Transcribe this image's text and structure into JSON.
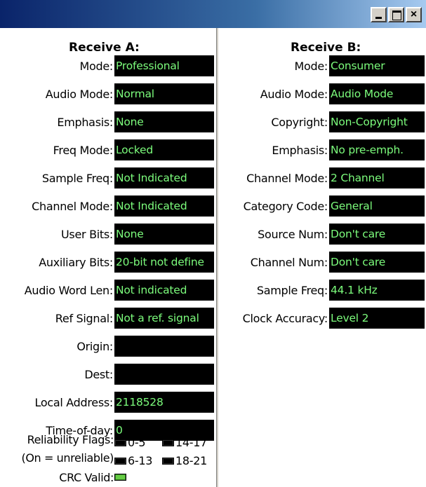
{
  "window": {
    "buttons": {
      "minimize": "_",
      "maximize": "□",
      "close": "×"
    }
  },
  "receive_a": {
    "heading": "Receive A:",
    "fields": [
      {
        "label": "Mode:",
        "value": "Professional"
      },
      {
        "label": "Audio Mode:",
        "value": "Normal"
      },
      {
        "label": "Emphasis:",
        "value": "None"
      },
      {
        "label": "Freq Mode:",
        "value": "Locked"
      },
      {
        "label": "Sample Freq:",
        "value": "Not Indicated"
      },
      {
        "label": "Channel Mode:",
        "value": "Not Indicated"
      },
      {
        "label": "User Bits:",
        "value": "None"
      },
      {
        "label": "Auxiliary Bits:",
        "value": "20-bit not define"
      },
      {
        "label": "Audio Word Len:",
        "value": "Not indicated"
      },
      {
        "label": "Ref Signal:",
        "value": "Not a ref. signal"
      },
      {
        "label": "Origin:",
        "value": ""
      },
      {
        "label": "Dest:",
        "value": ""
      },
      {
        "label": "Local Address:",
        "value": "2118528"
      },
      {
        "label": "Time-of-day:",
        "value": "0"
      }
    ],
    "reliability": {
      "label_line1": "Reliability Flags:",
      "label_line2": "(On = unreliable)",
      "flags": [
        "0-5",
        "14-17",
        "6-13",
        "18-21"
      ]
    },
    "crc": {
      "label": "CRC Valid:",
      "state": "on",
      "color": "#66cc44"
    }
  },
  "receive_b": {
    "heading": "Receive B:",
    "fields": [
      {
        "label": "Mode:",
        "value": "Consumer"
      },
      {
        "label": "Audio Mode:",
        "value": "Audio Mode"
      },
      {
        "label": "Copyright:",
        "value": "Non-Copyright"
      },
      {
        "label": "Emphasis:",
        "value": "No pre-emph."
      },
      {
        "label": "Channel Mode:",
        "value": "2 Channel"
      },
      {
        "label": "Category Code:",
        "value": "General"
      },
      {
        "label": "Source Num:",
        "value": "Don't care"
      },
      {
        "label": "Channel Num:",
        "value": "Don't care"
      },
      {
        "label": "Sample Freq:",
        "value": "44.1 kHz"
      },
      {
        "label": "Clock Accuracy:",
        "value": "Level 2"
      }
    ]
  },
  "colors": {
    "value_bg": "#000000",
    "value_text": "#7cfc7c",
    "panel_bg": "#ffffff"
  }
}
